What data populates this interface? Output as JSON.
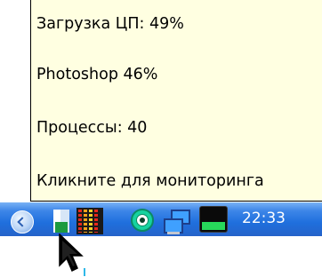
{
  "tooltip": {
    "lines": [
      "Загрузка ЦП: 49%",
      "Photoshop 46%",
      "Процессы: 40",
      "Кликните для мониторинга"
    ]
  },
  "taskbar": {
    "clock": "22:33",
    "tray_icons": [
      "back-arrow-icon",
      "blank-window-icon",
      "cpu-meter-icon",
      "target-icon",
      "network-icon",
      "green-monitor-icon"
    ]
  }
}
